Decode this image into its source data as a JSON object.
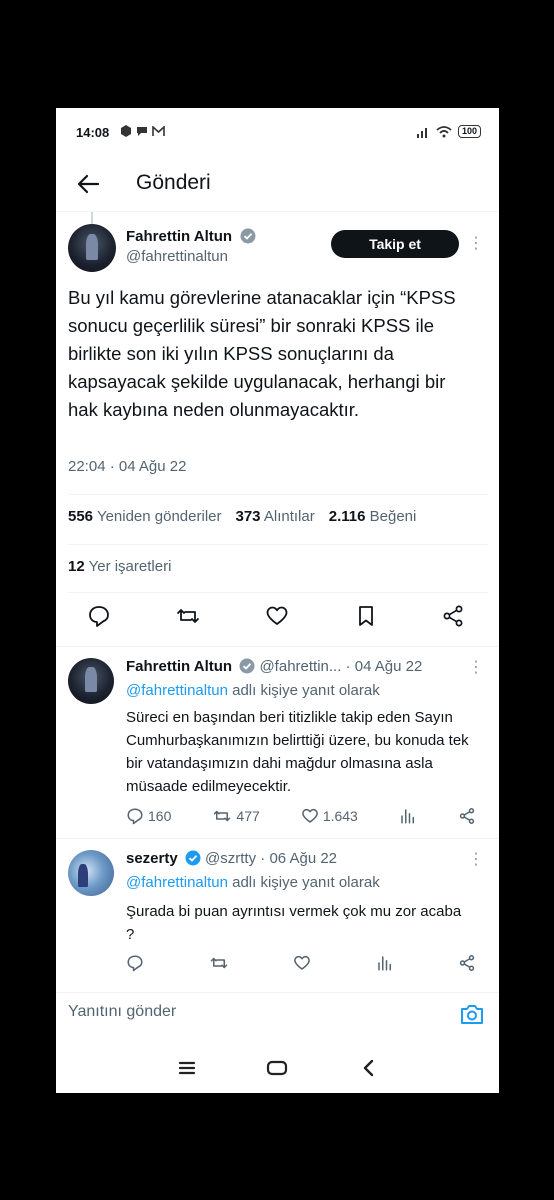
{
  "status_bar": {
    "time": "14:08",
    "battery": "100"
  },
  "header": {
    "title": "Gönderi"
  },
  "tweet": {
    "author_name": "Fahrettin Altun",
    "author_handle": "@fahrettinaltun",
    "follow_label": "Takip et",
    "text": "Bu yıl kamu görevlerine atanacaklar için “KPSS sonucu geçerlilik süresi” bir sonraki KPSS ile birlikte son iki yılın KPSS sonuçlarını da kapsayacak şekilde uygulanacak, herhangi bir hak kaybına neden olunmayacaktır.",
    "timestamp": "22:04 · 04 Ağu 22",
    "retweets_count": "556",
    "retweets_label": "Yeniden gönderiler",
    "quotes_count": "373",
    "quotes_label": "Alıntılar",
    "likes_count": "2.116",
    "likes_label": "Beğeni",
    "bookmarks_count": "12",
    "bookmarks_label": "Yer işaretleri"
  },
  "replies": [
    {
      "author_name": "Fahrettin Altun",
      "author_handle": "@fahrettin...",
      "date": "· 04 Ağu 22",
      "replying_to": "@fahrettinaltun",
      "replying_suffix": "adlı kişiye yanıt olarak",
      "text": "Süreci en başından beri titizlikle takip eden Sayın Cumhurbaşkanımızın belirttiği üzere, bu konuda tek bir vatandaşımızın dahi mağdur olmasına asla müsaade edilmeyecektir.",
      "reply_count": "160",
      "retweet_count": "477",
      "like_count": "1.643"
    },
    {
      "author_name": "sezerty",
      "author_handle": "@szrtty",
      "date": "· 06 Ağu 22",
      "replying_to": "@fahrettinaltun",
      "replying_suffix": "adlı kişiye yanıt olarak",
      "text": "Şurada bi puan ayrıntısı vermek çok mu zor acaba ?"
    }
  ],
  "compose": {
    "placeholder": "Yanıtını gönder"
  },
  "colors": {
    "accent": "#1d9bf0",
    "text": "#0f1419",
    "muted": "#536471"
  }
}
